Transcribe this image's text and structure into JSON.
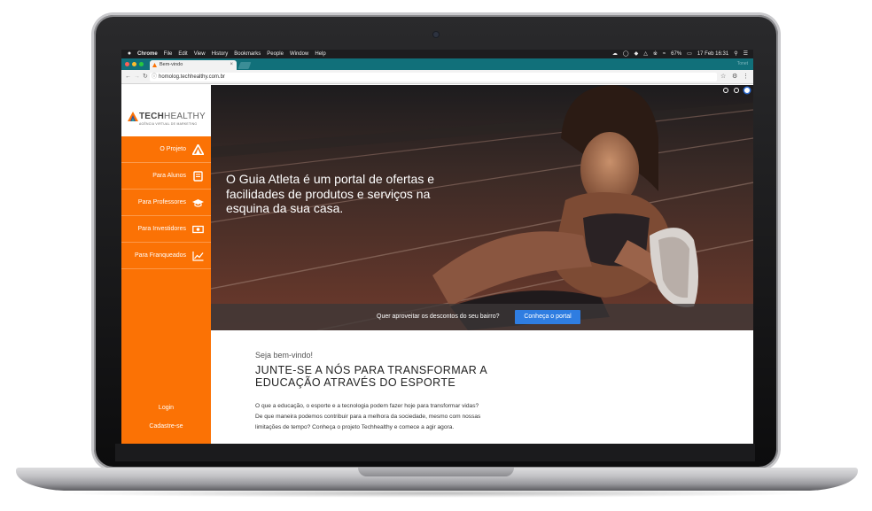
{
  "menubar": {
    "apple": "",
    "items": [
      "Chrome",
      "File",
      "Edit",
      "View",
      "History",
      "Bookmarks",
      "People",
      "Window",
      "Help"
    ],
    "battery": "67%",
    "datetime": "17 Feb 16:31"
  },
  "browser": {
    "tab_title": "Bem-vindo",
    "tab_close": "×",
    "url": "homolog.techhealthy.com.br",
    "profile": "Tonet"
  },
  "site": {
    "logo": {
      "word_bold": "TECH",
      "word_light": "HEALTHY",
      "tagline": "AGÊNCIA VIRTUAL DE MARKETING"
    },
    "nav": [
      {
        "label": "O Projeto",
        "icon": "triangle-logo-icon"
      },
      {
        "label": "Para Alunos",
        "icon": "book-icon"
      },
      {
        "label": "Para Professores",
        "icon": "graduation-cap-icon"
      },
      {
        "label": "Para Investidores",
        "icon": "money-bill-icon"
      },
      {
        "label": "Para Franqueados",
        "icon": "chart-line-icon"
      }
    ],
    "login": "Login",
    "signup": "Cadastre-se",
    "hero": {
      "headline": "O Guia Atleta é um portal de ofertas e facilidades de produtos e serviços na esquina da sua casa.",
      "cta_text": "Quer aproveitar os descontos do seu bairro?",
      "cta_button": "Conheça o portal",
      "slides": 3,
      "active_slide": 3
    },
    "intro": {
      "welcome": "Seja bem-vindo!",
      "title": "JUNTE-SE A NÓS PARA TRANSFORMAR A EDUCAÇÃO ATRAVÉS DO ESPORTE",
      "body": "O que a educação, o esporte e a tecnologia podem fazer hoje para transformar vidas? De que maneira podemos contribuir para a melhora da sociedade, mesmo com nossas limitações de tempo? Conheça o projeto Techhealthy e comece a agir agora."
    }
  },
  "colors": {
    "accent": "#fb7205",
    "tabstrip": "#11707a",
    "cta_button": "#2f7de1"
  }
}
